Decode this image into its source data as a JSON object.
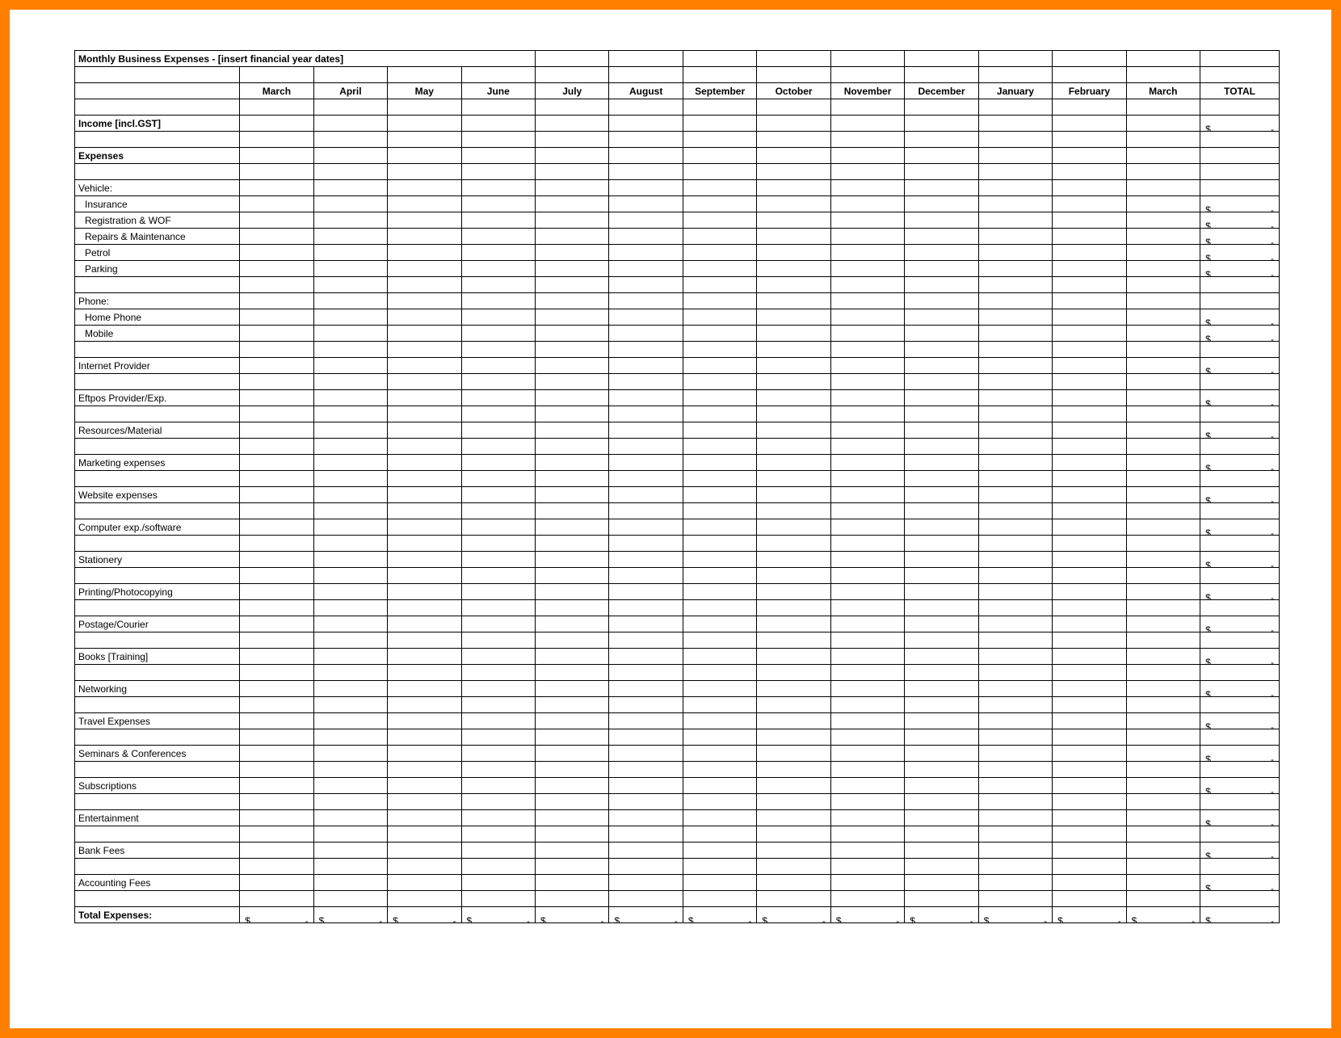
{
  "title": "Monthly Business Expenses - [insert financial year dates]",
  "months": [
    "March",
    "April",
    "May",
    "June",
    "July",
    "August",
    "September",
    "October",
    "November",
    "December",
    "January",
    "February",
    "March"
  ],
  "totalHeader": "TOTAL",
  "currency": "$",
  "dash": "-",
  "rows": [
    {
      "type": "blank"
    },
    {
      "type": "line",
      "label": "Income [incl.GST]",
      "bold": true,
      "indent": false,
      "total": true
    },
    {
      "type": "blank"
    },
    {
      "type": "line",
      "label": "Expenses",
      "bold": true,
      "indent": false,
      "total": false
    },
    {
      "type": "blank"
    },
    {
      "type": "line",
      "label": "Vehicle:",
      "bold": false,
      "indent": false,
      "total": false
    },
    {
      "type": "line",
      "label": "Insurance",
      "bold": false,
      "indent": true,
      "total": true
    },
    {
      "type": "line",
      "label": "Registration & WOF",
      "bold": false,
      "indent": true,
      "total": true
    },
    {
      "type": "line",
      "label": "Repairs & Maintenance",
      "bold": false,
      "indent": true,
      "total": true
    },
    {
      "type": "line",
      "label": "Petrol",
      "bold": false,
      "indent": true,
      "total": true
    },
    {
      "type": "line",
      "label": "Parking",
      "bold": false,
      "indent": true,
      "total": true
    },
    {
      "type": "blank"
    },
    {
      "type": "line",
      "label": "Phone:",
      "bold": false,
      "indent": false,
      "total": false
    },
    {
      "type": "line",
      "label": "Home Phone",
      "bold": false,
      "indent": true,
      "total": true
    },
    {
      "type": "line",
      "label": "Mobile",
      "bold": false,
      "indent": true,
      "total": true
    },
    {
      "type": "blank"
    },
    {
      "type": "line",
      "label": "Internet Provider",
      "bold": false,
      "indent": false,
      "total": true
    },
    {
      "type": "blank"
    },
    {
      "type": "line",
      "label": "Eftpos Provider/Exp.",
      "bold": false,
      "indent": false,
      "total": true
    },
    {
      "type": "blank"
    },
    {
      "type": "line",
      "label": "Resources/Material",
      "bold": false,
      "indent": false,
      "total": true
    },
    {
      "type": "blank"
    },
    {
      "type": "line",
      "label": "Marketing expenses",
      "bold": false,
      "indent": false,
      "total": true
    },
    {
      "type": "blank"
    },
    {
      "type": "line",
      "label": "Website expenses",
      "bold": false,
      "indent": false,
      "total": true
    },
    {
      "type": "blank"
    },
    {
      "type": "line",
      "label": "Computer exp./software",
      "bold": false,
      "indent": false,
      "total": true
    },
    {
      "type": "blank"
    },
    {
      "type": "line",
      "label": "Stationery",
      "bold": false,
      "indent": false,
      "total": true
    },
    {
      "type": "blank"
    },
    {
      "type": "line",
      "label": "Printing/Photocopying",
      "bold": false,
      "indent": false,
      "total": true
    },
    {
      "type": "blank"
    },
    {
      "type": "line",
      "label": "Postage/Courier",
      "bold": false,
      "indent": false,
      "total": true
    },
    {
      "type": "blank"
    },
    {
      "type": "line",
      "label": "Books [Training]",
      "bold": false,
      "indent": false,
      "total": true
    },
    {
      "type": "blank"
    },
    {
      "type": "line",
      "label": "Networking",
      "bold": false,
      "indent": false,
      "total": true
    },
    {
      "type": "blank"
    },
    {
      "type": "line",
      "label": "Travel Expenses",
      "bold": false,
      "indent": false,
      "total": true
    },
    {
      "type": "blank"
    },
    {
      "type": "line",
      "label": "Seminars & Conferences",
      "bold": false,
      "indent": false,
      "total": true
    },
    {
      "type": "blank"
    },
    {
      "type": "line",
      "label": "Subscriptions",
      "bold": false,
      "indent": false,
      "total": true
    },
    {
      "type": "blank"
    },
    {
      "type": "line",
      "label": "Entertainment",
      "bold": false,
      "indent": false,
      "total": true
    },
    {
      "type": "blank"
    },
    {
      "type": "line",
      "label": "Bank Fees",
      "bold": false,
      "indent": false,
      "total": true
    },
    {
      "type": "blank"
    },
    {
      "type": "line",
      "label": "Accounting Fees",
      "bold": false,
      "indent": false,
      "total": true
    },
    {
      "type": "blank"
    },
    {
      "type": "totals",
      "label": "Total Expenses:",
      "bold": true
    }
  ]
}
